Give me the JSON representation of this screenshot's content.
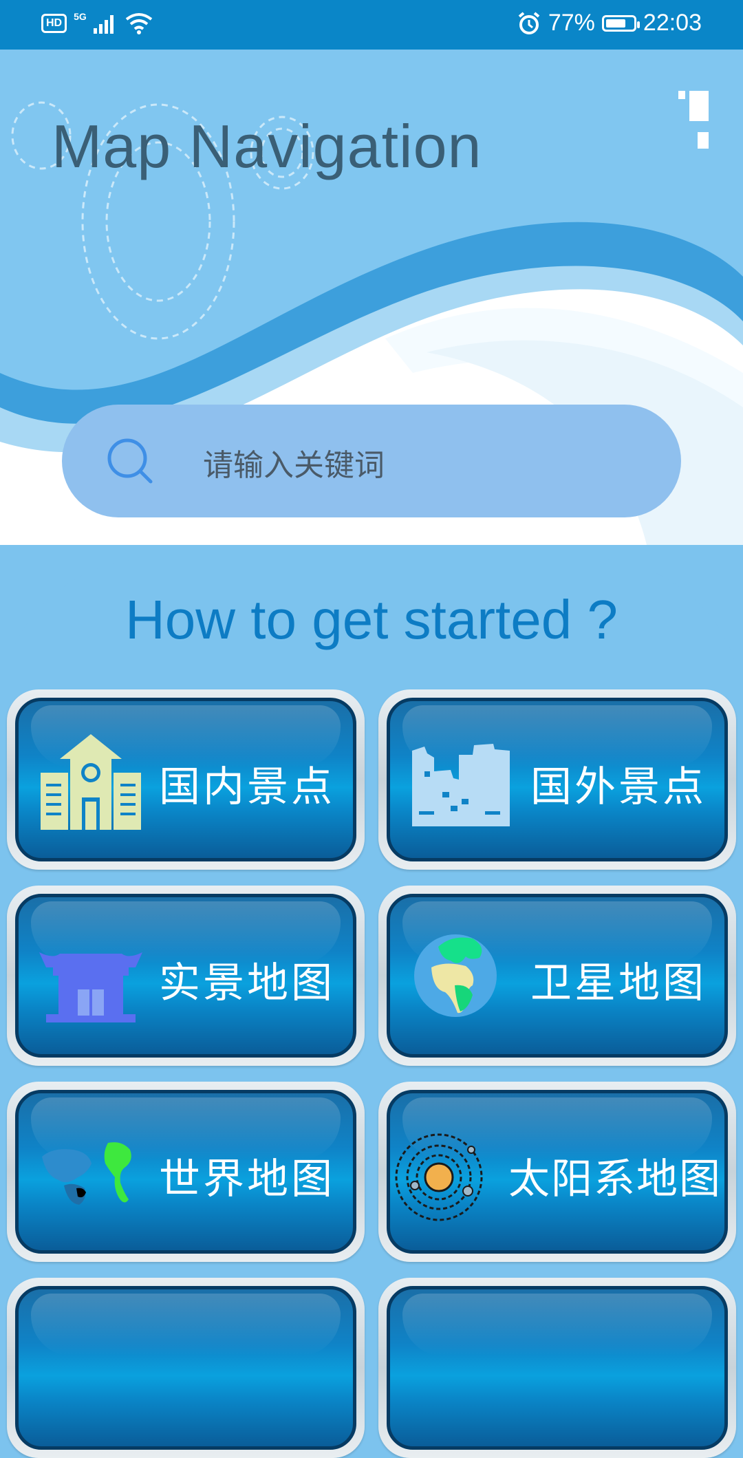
{
  "status_bar": {
    "hd": "HD",
    "network": "5G",
    "battery_percent": "77%",
    "battery_level": 0.77,
    "time": "22:03",
    "icons": [
      "hd-icon",
      "signal-icon",
      "wifi-icon",
      "alarm-icon",
      "battery-icon"
    ]
  },
  "header": {
    "title": "Map Navigation",
    "menu_icon": "menu-icon"
  },
  "search": {
    "placeholder": "请输入关键词",
    "icon": "search-icon"
  },
  "panel": {
    "title": "How to get started ?"
  },
  "tiles": [
    {
      "label": "国内景点",
      "icon": "building-icon"
    },
    {
      "label": "国外景点",
      "icon": "city-icon"
    },
    {
      "label": "实景地图",
      "icon": "temple-icon"
    },
    {
      "label": "卫星地图",
      "icon": "earth-icon"
    },
    {
      "label": "世界地图",
      "icon": "world-map-icon"
    },
    {
      "label": "太阳系地图",
      "icon": "solar-system-icon"
    }
  ],
  "colors": {
    "status_bar": "#0a86c8",
    "background": "#7cc3ee",
    "title_text": "#3a5f76",
    "panel_title": "#0d7cc4",
    "search_bg": "#8fc0ee"
  }
}
